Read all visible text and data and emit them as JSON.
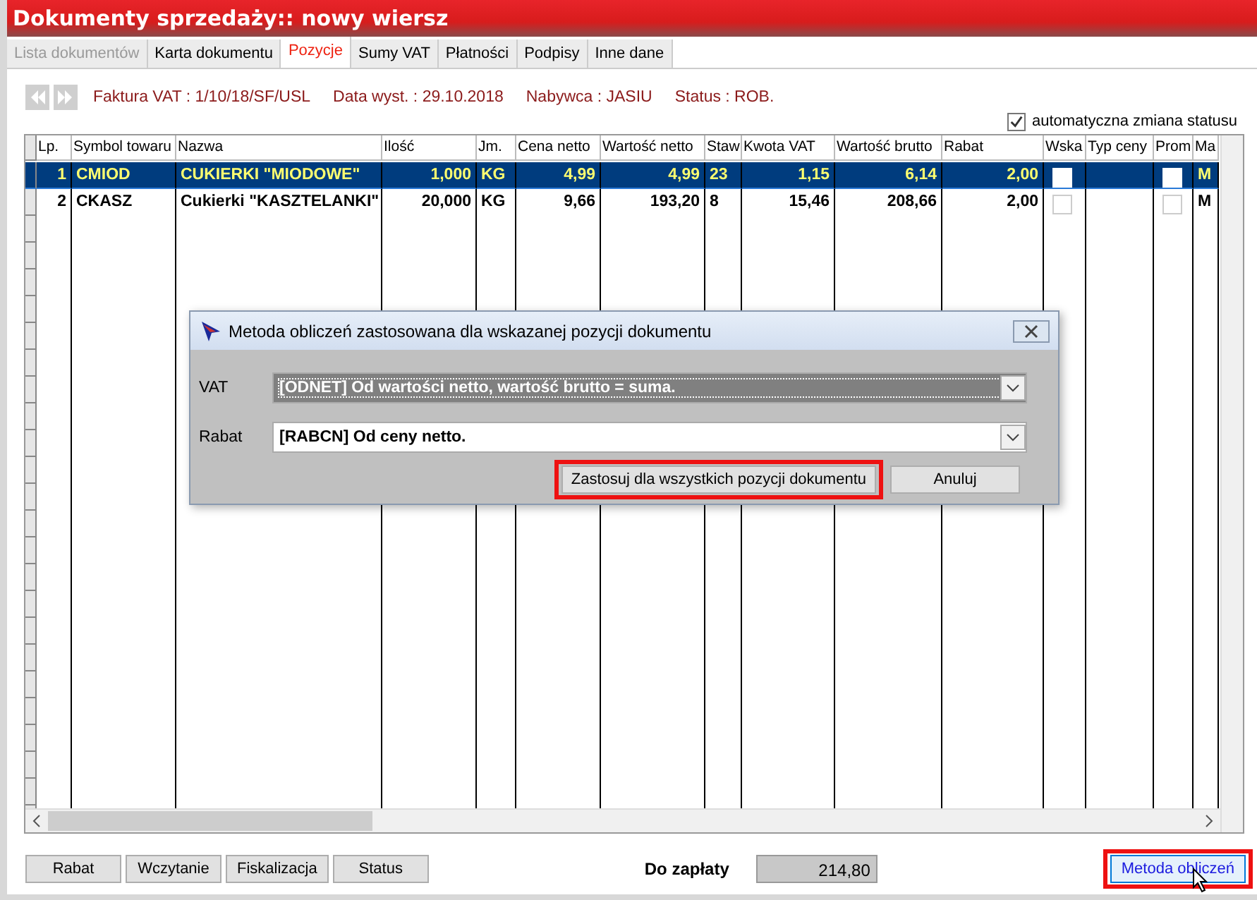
{
  "window": {
    "title": "Dokumenty sprzedaży:: nowy wiersz"
  },
  "tabs": [
    {
      "label": "Lista dokumentów",
      "selected": false,
      "disabled": true
    },
    {
      "label": "Karta dokumentu",
      "selected": false,
      "disabled": false
    },
    {
      "label": "Pozycje",
      "selected": true,
      "disabled": false
    },
    {
      "label": "Sumy VAT",
      "selected": false,
      "disabled": false
    },
    {
      "label": "Płatności",
      "selected": false,
      "disabled": false
    },
    {
      "label": "Podpisy",
      "selected": false,
      "disabled": false
    },
    {
      "label": "Inne dane",
      "selected": false,
      "disabled": false
    }
  ],
  "info": [
    "Faktura VAT : 1/10/18/SF/USL",
    "Data wyst. : 29.10.2018",
    "Nabywca : JASIU",
    "Status : ROB."
  ],
  "auto_status": {
    "label": "automatyczna zmiana statusu",
    "checked": true
  },
  "table": {
    "columns": [
      {
        "label": "Lp.",
        "kind": "number"
      },
      {
        "label": "Symbol towaru",
        "kind": "text"
      },
      {
        "label": "Nazwa",
        "kind": "text"
      },
      {
        "label": "Ilość",
        "kind": "number"
      },
      {
        "label": "Jm.",
        "kind": "text"
      },
      {
        "label": "Cena netto",
        "kind": "number"
      },
      {
        "label": "Wartość netto",
        "kind": "number"
      },
      {
        "label": "Staw",
        "kind": "text"
      },
      {
        "label": "Kwota VAT",
        "kind": "number"
      },
      {
        "label": "Wartość brutto",
        "kind": "number"
      },
      {
        "label": "Rabat",
        "kind": "number"
      },
      {
        "label": "Wska",
        "kind": "check"
      },
      {
        "label": "Typ ceny",
        "kind": "text"
      },
      {
        "label": "Prom",
        "kind": "check"
      },
      {
        "label": "Ma",
        "kind": "text"
      }
    ],
    "rows": [
      {
        "selected": true,
        "cells": [
          "1",
          "CMIOD",
          "CUKIERKI \"MIODOWE\"",
          "1,000",
          "KG",
          "4,99",
          "4,99",
          "23",
          "1,15",
          "6,14",
          "2,00",
          false,
          "",
          false,
          "M"
        ]
      },
      {
        "selected": false,
        "cells": [
          "2",
          "CKASZ",
          "Cukierki \"KASZTELANKI\"",
          "20,000",
          "KG",
          "9,66",
          "193,20",
          "8",
          "15,46",
          "208,66",
          "2,00",
          false,
          "",
          false,
          "M"
        ]
      }
    ]
  },
  "dialog": {
    "title": "Metoda obliczeń zastosowana dla wskazanej pozycji dokumentu",
    "fields": [
      {
        "label": "VAT",
        "value": "[ODNET] Od wartości netto, wartość brutto = suma.",
        "focused": true
      },
      {
        "label": "Rabat",
        "value": "[RABCN] Od ceny netto.",
        "focused": false
      }
    ],
    "buttons": [
      {
        "label": "Zastosuj dla wszystkich pozycji dokumentu",
        "highlighted": true
      },
      {
        "label": "Anuluj",
        "highlighted": false
      }
    ]
  },
  "footer": {
    "buttons": [
      "Rabat",
      "Wczytanie",
      "Fiskalizacja",
      "Status"
    ],
    "total_label": "Do zapłaty",
    "total_value": "214,80",
    "method_button": {
      "label": "Metoda obliczeń",
      "highlighted": true
    }
  }
}
